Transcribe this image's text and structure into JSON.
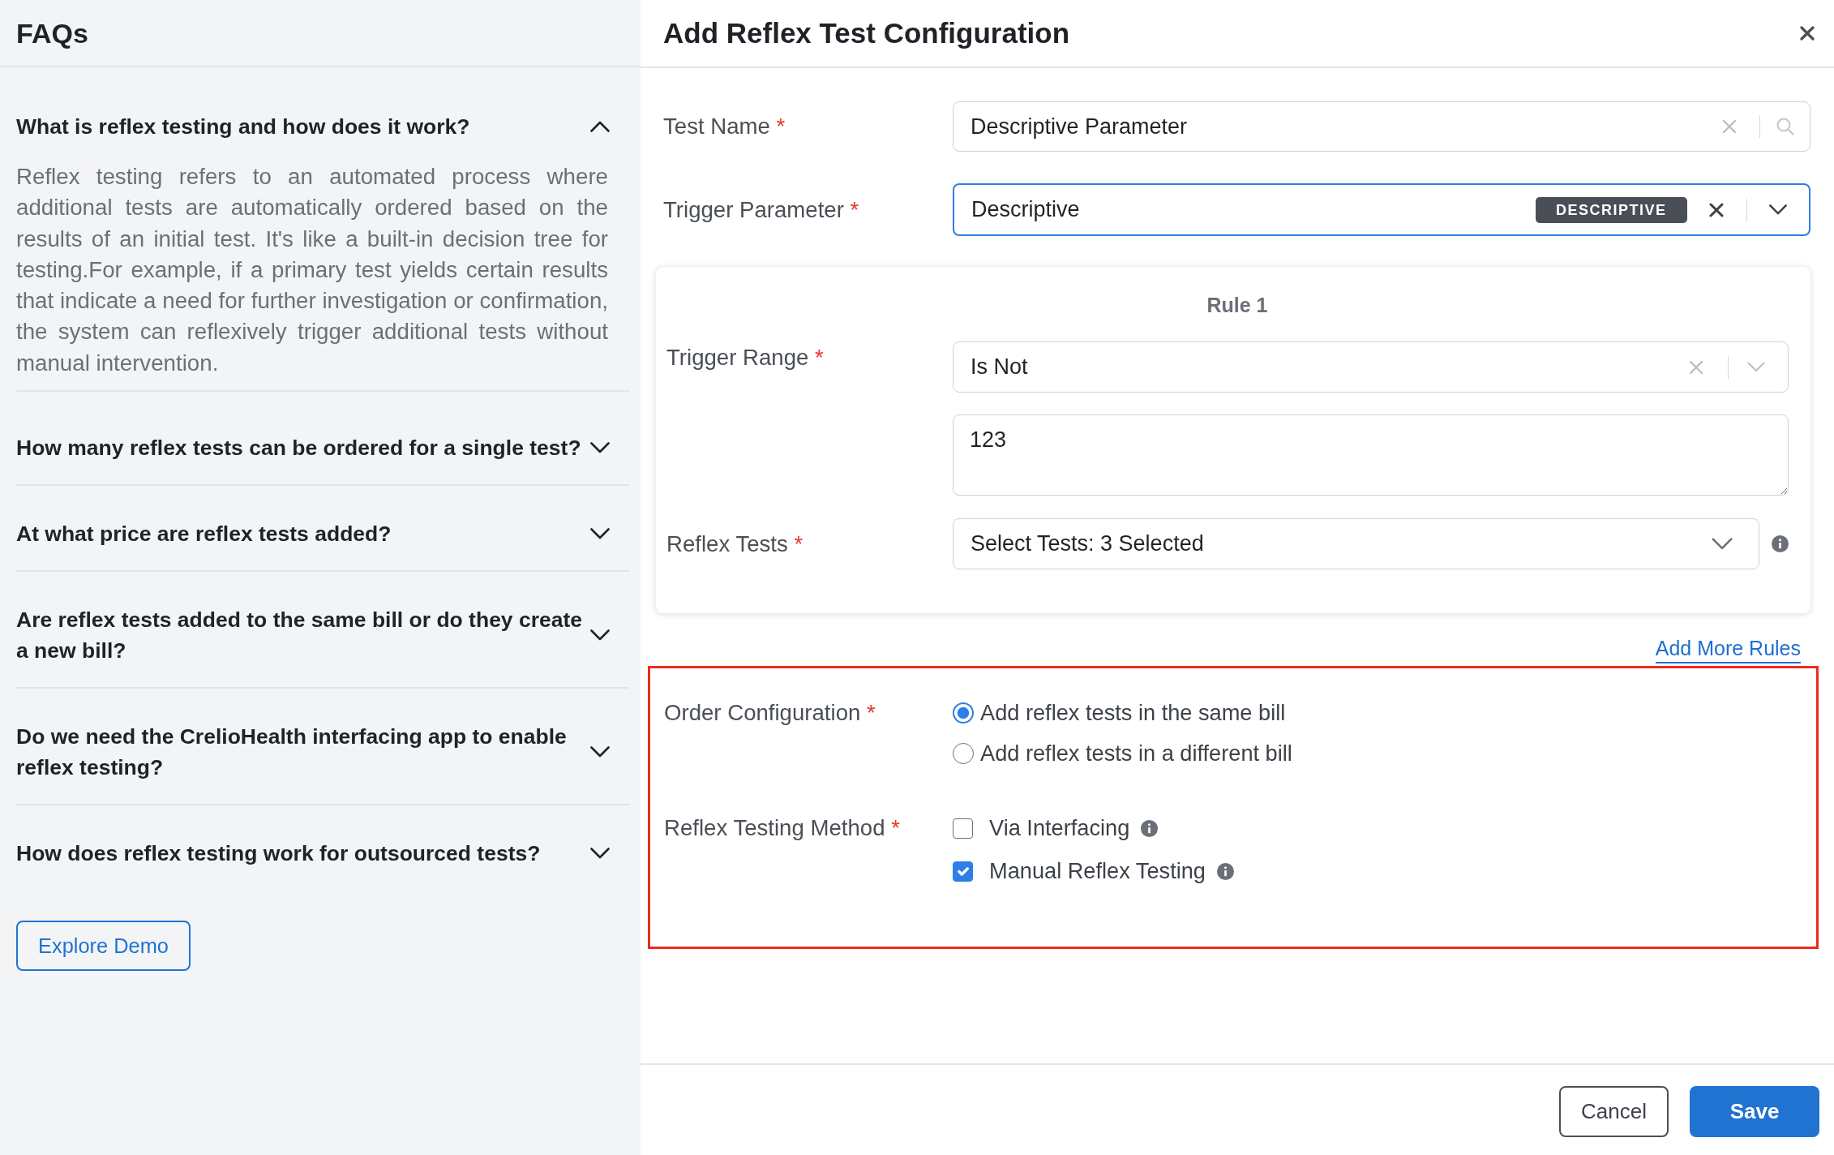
{
  "faq_panel": {
    "title": "FAQs",
    "items": [
      {
        "question": "What is reflex testing and how does it work?",
        "expanded": true,
        "answer": "Reflex testing refers to an automated process where additional tests are automatically ordered based on the results of an initial test. It's like a built-in decision tree for testing.For example, if a primary test yields certain results that indicate a need for further investigation or confirmation, the system can reflexively trigger additional tests without manual intervention."
      },
      {
        "question": "How many reflex tests can be ordered for a single test?",
        "expanded": false
      },
      {
        "question": "At what price are reflex tests added?",
        "expanded": false
      },
      {
        "question": "Are reflex tests added to the same bill or do they create a new bill?",
        "expanded": false
      },
      {
        "question": "Do we need the CrelioHealth interfacing app to enable reflex testing?",
        "expanded": false
      },
      {
        "question": "How does reflex testing work for outsourced tests?",
        "expanded": false
      }
    ],
    "demo_button": "Explore Demo"
  },
  "dialog": {
    "title": "Add Reflex Test Configuration",
    "fields": [
      {
        "kind": "search",
        "label": "Test Name",
        "required_mark": "*",
        "value": "Descriptive Parameter",
        "focused": false
      },
      {
        "kind": "select",
        "label": "Trigger Parameter",
        "required_mark": "*",
        "value": "Descriptive",
        "badge": "DESCRIPTIVE",
        "focused": true
      }
    ],
    "rules": [
      {
        "title": "Rule 1",
        "trigger_range": {
          "label": "Trigger Range",
          "required_mark": "*",
          "operator": "Is Not",
          "value": "123"
        },
        "reflex_tests": {
          "label": "Reflex Tests",
          "required_mark": "*",
          "value": "Select Tests: 3 Selected"
        }
      }
    ],
    "add_rules_link": "Add More Rules",
    "settings": {
      "highlighted": true,
      "order_configuration": {
        "label": "Order Configuration",
        "required_mark": "*",
        "options": [
          {
            "label": "Add reflex tests in the same bill",
            "selected": true
          },
          {
            "label": "Add reflex tests in a different bill",
            "selected": false
          }
        ]
      },
      "testing_method": {
        "label": "Reflex Testing Method",
        "required_mark": "*",
        "options": [
          {
            "label": "Via Interfacing",
            "checked": false
          },
          {
            "label": "Manual Reflex Testing",
            "checked": true
          }
        ]
      }
    },
    "buttons": [
      {
        "label": "Cancel",
        "kind": "cancel"
      },
      {
        "label": "Save",
        "kind": "save"
      }
    ]
  }
}
